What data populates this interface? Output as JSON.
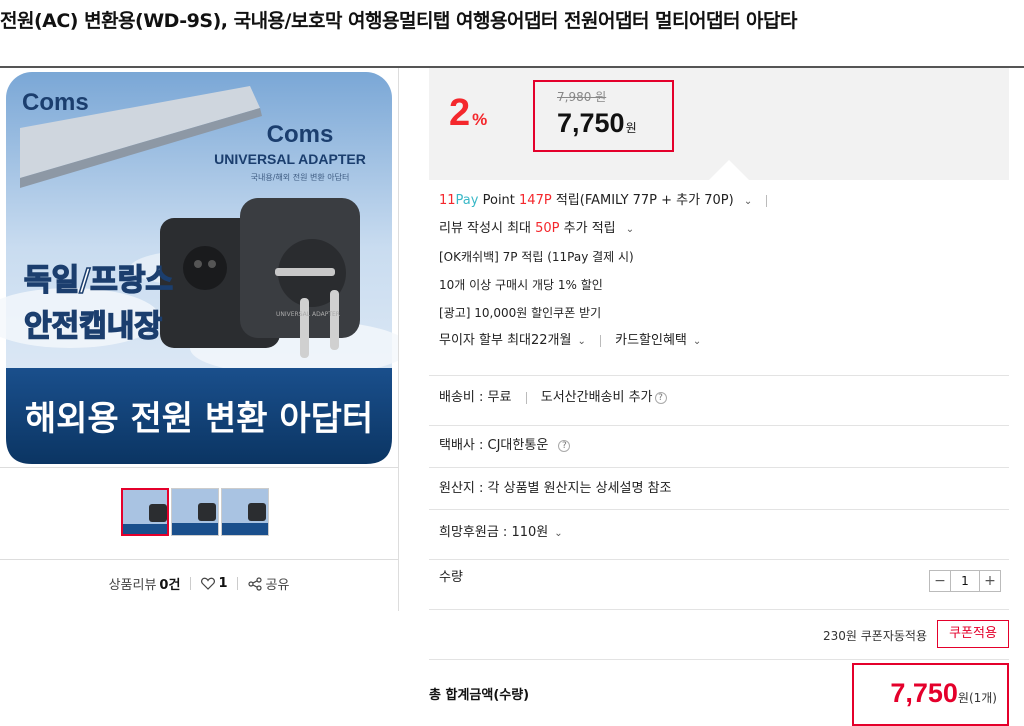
{
  "product": {
    "title": "전원(AC) 변환용(WD-9S), 국내용/보호막 여행용멀티탭 여행용어댑터 전원어댑터 멀티어댑터 아답타"
  },
  "image": {
    "brand_logo": "Coms",
    "brand_name": "Coms",
    "subtitle": "UNIVERSAL ADAPTER",
    "tagline": "국내용/해외 전원 변환 아답터",
    "text_line1": "독일/프랑스",
    "text_line2": "안전캡내장",
    "banner": "해외용 전원 변환 아답터",
    "plug_label": "UNIVERSAL ADAPTER"
  },
  "social": {
    "review_label": "상품리뷰",
    "review_count": "0건",
    "like_count": "1",
    "share_label": "공유"
  },
  "price": {
    "discount": "2",
    "discount_unit": "%",
    "original": "7,980 원",
    "sale": "7,750",
    "sale_unit": "원"
  },
  "benefits": {
    "pay_brand_a": "11",
    "pay_brand_b": "Pay",
    "pay_point_word": "Point",
    "point_amount": "147P",
    "point_detail": "적립(FAMILY 77P + 추가 70P)",
    "review_text": "리뷰 작성시 최대",
    "review_points": "50P",
    "review_suffix": "추가 적립",
    "ok_cashbag": "[OK캐쉬백] 7P 적립 (11Pay 결제 시)",
    "bulk_discount": "10개 이상 구매시 개당 1% 할인",
    "ad_coupon": "[광고] 10,000원 할인쿠폰 받기",
    "installment": "무이자 할부 최대22개월",
    "card_benefit": "카드할인혜택"
  },
  "shipping": {
    "fee_label": "배송비 : 무료",
    "remote_label": "도서산간배송비 추가",
    "courier_label": "택배사 : CJ대한통운",
    "origin_label": "원산지 : 각 상품별 원산지는 상세설명 참조",
    "donation_label": "희망후원금 : 110원"
  },
  "quantity": {
    "label": "수량",
    "value": "1",
    "minus": "−",
    "plus": "+"
  },
  "coupon": {
    "auto_text": "230원 쿠폰자동적용",
    "button": "쿠폰적용"
  },
  "total": {
    "label": "총 합계금액(수량)",
    "amount": "7,750",
    "unit": "원(1개)"
  },
  "colors": {
    "accent": "#e4002b",
    "discount": "#f4282d",
    "pay_teal": "#3ab8c7"
  }
}
